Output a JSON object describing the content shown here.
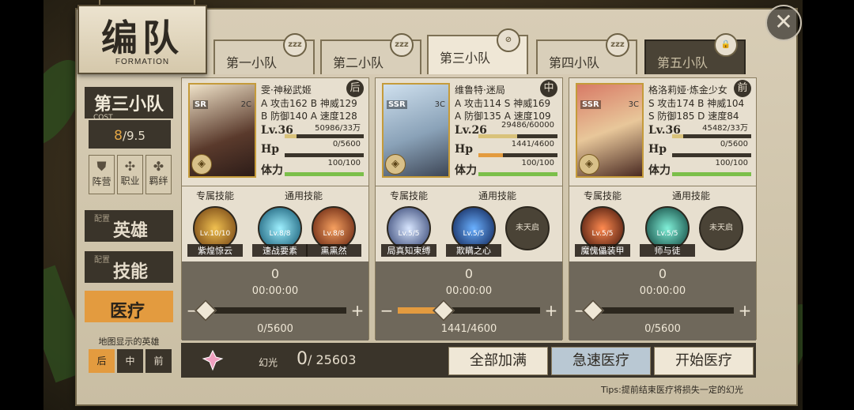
{
  "header": {
    "title": "编队",
    "subtitle": "FORMATION",
    "close": "✕"
  },
  "tabs": [
    {
      "label": "第一小队",
      "icon": "zzz"
    },
    {
      "label": "第二小队",
      "icon": "zzz"
    },
    {
      "label": "第三小队",
      "icon": "⊘"
    },
    {
      "label": "第四小队",
      "icon": "zzz"
    },
    {
      "label": "第五小队",
      "icon": "🔒"
    }
  ],
  "left": {
    "team": "第三小队",
    "cost_label": "COST",
    "cost_used": "8",
    "cost_max": "/9.5",
    "mini": [
      "阵营",
      "职业",
      "羁绊"
    ],
    "side": [
      {
        "sub": "配置",
        "main": "英雄"
      },
      {
        "sub": "配置",
        "main": "技能"
      },
      {
        "sub": "",
        "main": "医疗"
      }
    ],
    "map_label": "地图显示的英雄",
    "positions": [
      "后",
      "中",
      "前"
    ]
  },
  "heroes": [
    {
      "name": "雯·神秘武姬",
      "row": "后",
      "rarity": "SR",
      "cost": "2C",
      "stats": [
        "A 攻击162",
        "B 神威129",
        "B 防御140",
        "A 速度128"
      ],
      "lv": "Lv.36",
      "exp": "50986/33万",
      "hp": "0/5600",
      "stamina": "100/100",
      "hp_frac": 0.0,
      "exp_frac": 0.15,
      "skill_head": [
        "专属技能",
        "通用技能"
      ],
      "skills": [
        {
          "lv": "Lv.10/10",
          "name": "紫煌惊云"
        },
        {
          "lv": "Lv.8/8",
          "name": "速战要素"
        },
        {
          "lv": "Lv.8/8",
          "name": "熏熏然"
        }
      ],
      "heal_count": "0",
      "heal_time": "00:00:00",
      "heal_hp": "0/5600",
      "heal_frac": 0.0
    },
    {
      "name": "维鲁特·迷局",
      "row": "中",
      "rarity": "SSR",
      "cost": "3C",
      "stats": [
        "A 攻击114",
        "S 神威169",
        "A 防御135",
        "A 速度109"
      ],
      "lv": "Lv.26",
      "exp": "29486/60000",
      "hp": "1441/4600",
      "stamina": "100/100",
      "hp_frac": 0.31,
      "exp_frac": 0.49,
      "skill_head": [
        "专属技能",
        "通用技能"
      ],
      "skills": [
        {
          "lv": "Lv.5/5",
          "name": "局真知束缚"
        },
        {
          "lv": "Lv.5/5",
          "name": "欺瞒之心"
        },
        {
          "lv": "",
          "name": "未天启"
        }
      ],
      "heal_count": "0",
      "heal_time": "00:00:00",
      "heal_hp": "1441/4600",
      "heal_frac": 0.31
    },
    {
      "name": "格洛莉娅·炼金少女",
      "row": "前",
      "rarity": "SSR",
      "cost": "3C",
      "stats": [
        "S 攻击174",
        "B 神威104",
        "S 防御185",
        "D 速度84"
      ],
      "lv": "Lv.36",
      "exp": "45482/33万",
      "hp": "0/5600",
      "stamina": "100/100",
      "hp_frac": 0.0,
      "exp_frac": 0.14,
      "skill_head": [
        "专属技能",
        "通用技能"
      ],
      "skills": [
        {
          "lv": "Lv.5/5",
          "name": "魔傀儡装甲"
        },
        {
          "lv": "Lv.5/5",
          "name": "师与徒"
        },
        {
          "lv": "",
          "name": "未天启"
        }
      ],
      "heal_count": "0",
      "heal_time": "00:00:00",
      "heal_hp": "0/5600",
      "heal_frac": 0.0
    }
  ],
  "bottom": {
    "glow_label": "幻光",
    "glow_used": "0",
    "glow_total": "25603",
    "buttons": [
      "全部加满",
      "急速医疗",
      "开始医疗"
    ],
    "tips": "Tips:提前结束医疗将损失一定的幻光"
  },
  "colors": {
    "accent": "#e39b3f",
    "hp": "#e39b3f",
    "stamina": "#7bbf4a",
    "exp": "#d9c27a"
  }
}
